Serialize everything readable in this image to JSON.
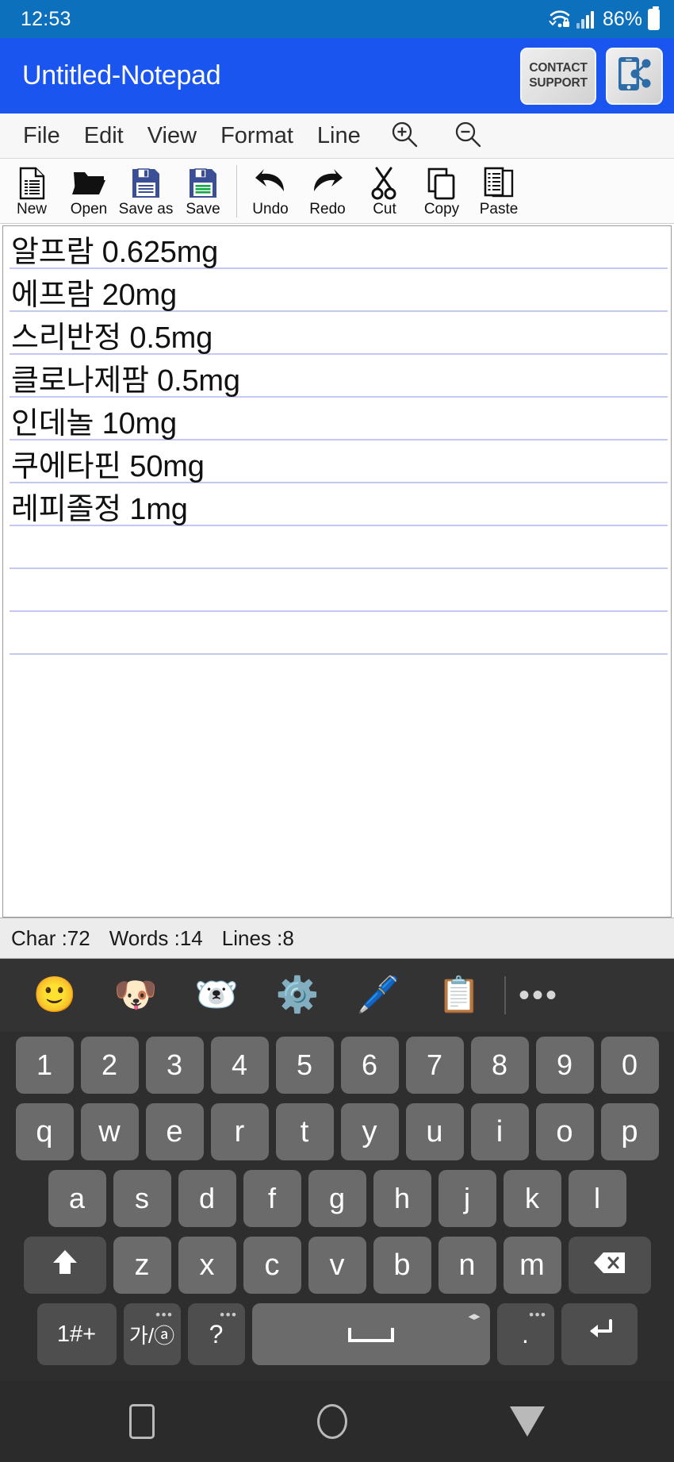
{
  "statusbar": {
    "time": "12:53",
    "battery_pct": "86%",
    "wifi_icon": "wifi-locked-icon",
    "signal_icon": "cellular-signal-icon",
    "battery_icon": "battery-icon"
  },
  "appbar": {
    "title": "Untitled-Notepad",
    "contact_support_line1": "CONTACT",
    "contact_support_line2": "SUPPORT",
    "share_icon": "share-phone-icon",
    "background_color": "#1b55f0"
  },
  "menubar": {
    "items": [
      {
        "label": "File"
      },
      {
        "label": "Edit"
      },
      {
        "label": "View"
      },
      {
        "label": "Format"
      },
      {
        "label": "Line"
      }
    ],
    "zoom_in_icon": "zoom-in-icon",
    "zoom_out_icon": "zoom-out-icon"
  },
  "toolbar": {
    "group_file": [
      {
        "label": "New",
        "icon": "new-document-icon"
      },
      {
        "label": "Open",
        "icon": "open-folder-icon"
      },
      {
        "label": "Save as",
        "icon": "save-as-floppy-icon"
      },
      {
        "label": "Save",
        "icon": "save-floppy-icon"
      }
    ],
    "group_edit": [
      {
        "label": "Undo",
        "icon": "undo-arrow-icon"
      },
      {
        "label": "Redo",
        "icon": "redo-arrow-icon"
      },
      {
        "label": "Cut",
        "icon": "scissors-icon"
      },
      {
        "label": "Copy",
        "icon": "copy-icon"
      },
      {
        "label": "Paste",
        "icon": "paste-icon"
      }
    ]
  },
  "editor": {
    "lines": [
      "알프람 0.625mg",
      "에프람 20mg",
      "스리반정 0.5mg",
      "클로나제팜 0.5mg",
      "인데놀 10mg",
      "쿠에타핀 50mg",
      "레피졸정 1mg"
    ],
    "rule_color": "#c3c9f2"
  },
  "countbar": {
    "chars": "Char :72",
    "words": "Words :14",
    "lines": "Lines :8"
  },
  "keyboard": {
    "toolbar": [
      {
        "icon": "emoji-smiley-icon",
        "glyph": "🙂"
      },
      {
        "icon": "ar-emoji-dog-icon",
        "glyph": "🐶"
      },
      {
        "icon": "sticker-polar-bear-icon",
        "glyph": "🐻‍❄️"
      },
      {
        "icon": "settings-gear-icon",
        "glyph": "⚙️"
      },
      {
        "icon": "handwriting-pen-icon",
        "glyph": "🖊️"
      },
      {
        "icon": "clipboard-icon",
        "glyph": "📋"
      }
    ],
    "more_label": "•••",
    "row_numbers": [
      "1",
      "2",
      "3",
      "4",
      "5",
      "6",
      "7",
      "8",
      "9",
      "0"
    ],
    "row_top": [
      "q",
      "w",
      "e",
      "r",
      "t",
      "y",
      "u",
      "i",
      "o",
      "p"
    ],
    "row_home": [
      "a",
      "s",
      "d",
      "f",
      "g",
      "h",
      "j",
      "k",
      "l"
    ],
    "row_bottom": [
      "z",
      "x",
      "c",
      "v",
      "b",
      "n",
      "m"
    ],
    "shift_icon": "shift-arrow-icon",
    "backspace_icon": "backspace-icon",
    "symbols_label": "1#+",
    "language_label": "가/ⓐ",
    "question_label": "?",
    "space_icon": "space-bar-icon",
    "period_label": ".",
    "enter_icon": "enter-return-icon",
    "dots_label": "•••"
  },
  "navbar": {
    "recents_icon": "recents-square-icon",
    "home_icon": "home-circle-icon",
    "back_icon": "back-triangle-icon"
  }
}
